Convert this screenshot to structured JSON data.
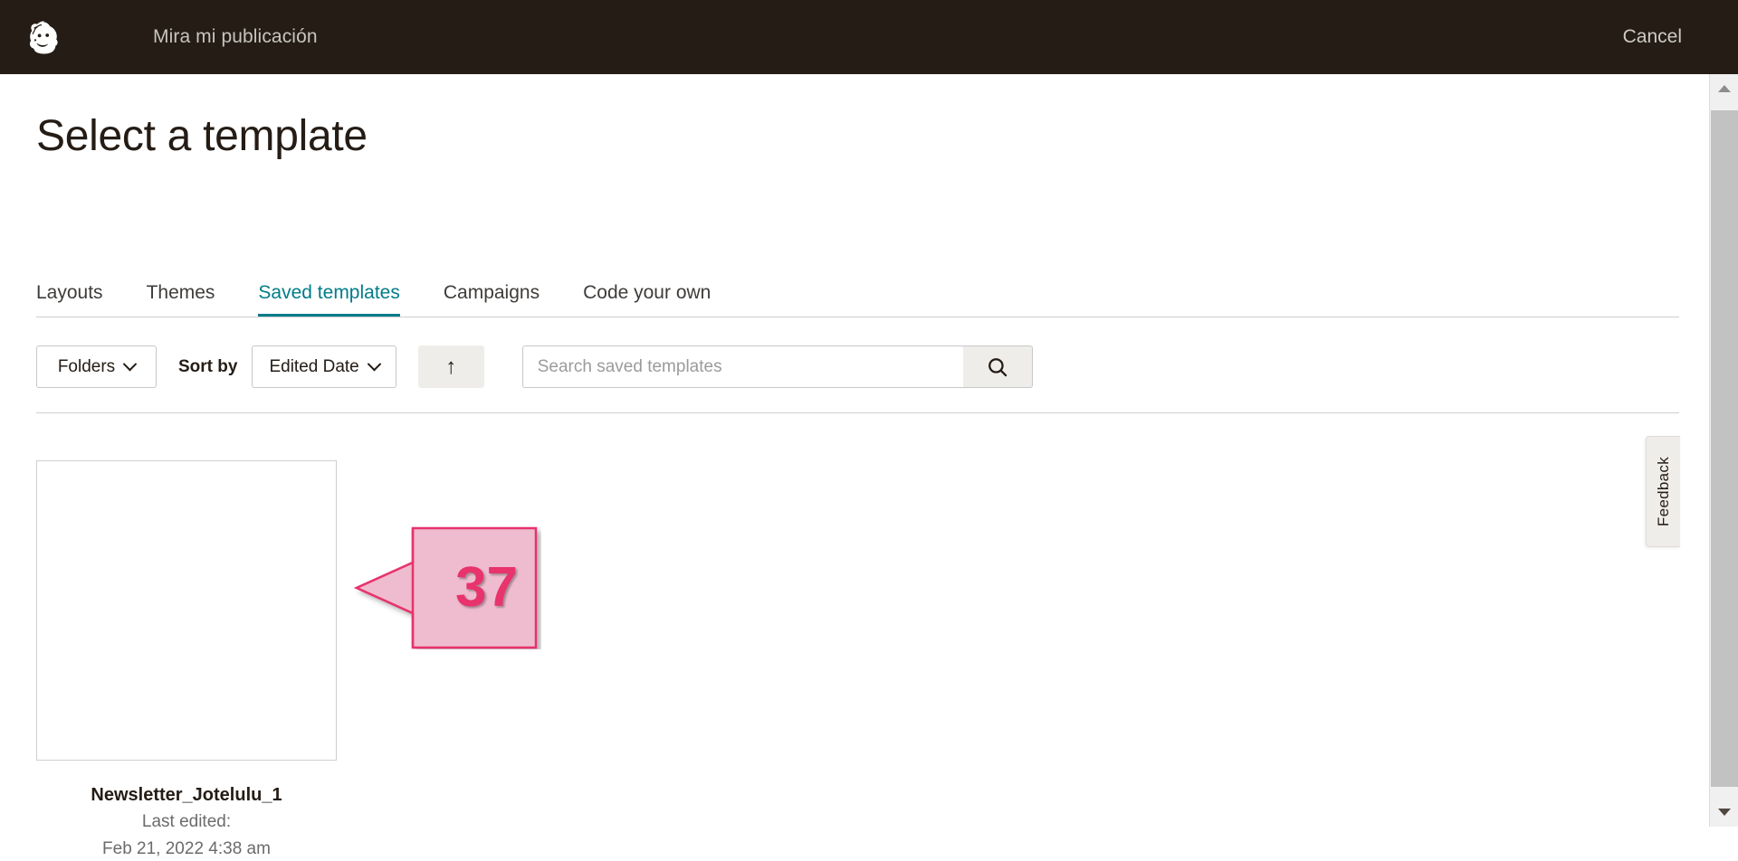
{
  "topbar": {
    "logo_icon": "mailchimp-freddie-logo",
    "campaign_title": "Mira mi publicación",
    "cancel_label": "Cancel",
    "background_color": "#241c15",
    "text_color": "#c8c3bd"
  },
  "page": {
    "title": "Select a template"
  },
  "tabs": {
    "active_index": 2,
    "accent_color": "#007c89",
    "items": [
      {
        "label": "Layouts"
      },
      {
        "label": "Themes"
      },
      {
        "label": "Saved templates"
      },
      {
        "label": "Campaigns"
      },
      {
        "label": "Code your own"
      }
    ]
  },
  "filters": {
    "folders_label": "Folders",
    "folders_icon": "chevron-down-icon",
    "sort_by_label": "Sort by",
    "sort_value": "Edited Date",
    "sort_icon": "chevron-down-icon",
    "sort_direction_icon": "arrow-up-icon",
    "sort_direction": "↑",
    "search_value": "",
    "search_placeholder": "Search saved templates",
    "search_icon": "search-icon"
  },
  "templates": [
    {
      "name": "Newsletter_Jotelulu_1",
      "last_edited_label": "Last edited:",
      "last_edited_value": "Feb 21, 2022 4:38 am",
      "thumbnail": "blank-template-preview"
    }
  ],
  "annotation": {
    "number": "37",
    "fill_color": "#eebcce",
    "border_color": "#e8336d",
    "text_color": "#e8336d",
    "direction": "left-arrow"
  },
  "feedback": {
    "label": "Feedback"
  },
  "scrollbar": {
    "up_icon": "scroll-up-arrow-icon",
    "down_icon": "scroll-down-arrow-icon"
  }
}
